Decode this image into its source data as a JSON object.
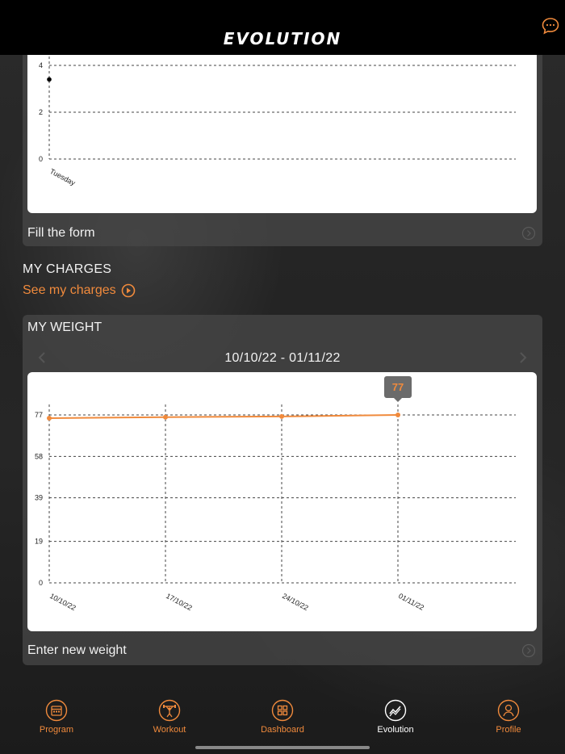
{
  "header": {
    "title": "EVOLUTION",
    "chat_icon": "chat-bubble-icon"
  },
  "top_card": {
    "link_label": "Fill the form",
    "chart": {
      "y_ticks": [
        "0",
        "2",
        "4"
      ],
      "x_labels": [
        "Tuesday"
      ]
    }
  },
  "charges": {
    "title": "MY CHARGES",
    "link_label": "See my charges"
  },
  "weight": {
    "title": "MY WEIGHT",
    "date_range": "10/10/22 - 01/11/22",
    "tooltip": "77",
    "link_label": "Enter new weight"
  },
  "tabs": [
    {
      "label": "Program",
      "icon": "calendar-icon",
      "active": false
    },
    {
      "label": "Workout",
      "icon": "weightlifter-icon",
      "active": false
    },
    {
      "label": "Dashboard",
      "icon": "grid-icon",
      "active": false
    },
    {
      "label": "Evolution",
      "icon": "trend-line-icon",
      "active": true
    },
    {
      "label": "Profile",
      "icon": "person-icon",
      "active": false
    }
  ],
  "colors": {
    "accent": "#f08a3c",
    "header_bg": "#000000"
  },
  "chart_data": [
    {
      "type": "scatter",
      "title": "",
      "categories": [
        "Tuesday"
      ],
      "series": [
        {
          "values": [
            3.4
          ]
        }
      ],
      "ylim": [
        0,
        4
      ],
      "y_ticks": [
        0,
        2,
        4
      ],
      "grid": true
    },
    {
      "type": "line",
      "title": "",
      "categories": [
        "10/10/22",
        "17/10/22",
        "24/10/22",
        "01/11/22"
      ],
      "series": [
        {
          "values": [
            75.5,
            76,
            76.3,
            77
          ]
        }
      ],
      "ylim": [
        0,
        77
      ],
      "y_ticks": [
        0,
        19,
        39,
        58,
        77
      ],
      "grid": true
    }
  ]
}
